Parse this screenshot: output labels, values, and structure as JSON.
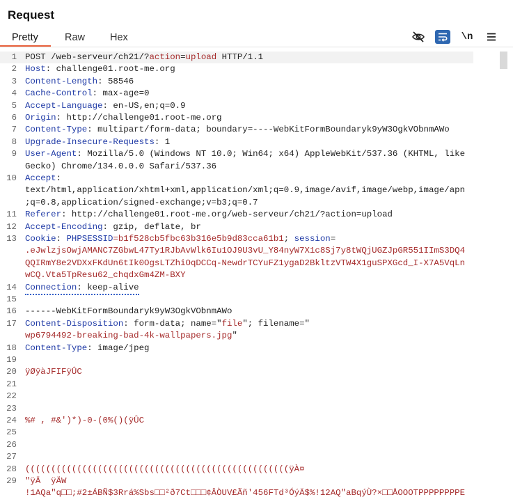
{
  "panel": {
    "title": "Request"
  },
  "tabs": [
    {
      "label": "Pretty"
    },
    {
      "label": "Raw"
    },
    {
      "label": "Hex"
    }
  ],
  "toolbar": {
    "hide_icon": "eye-slash-icon",
    "wrap_icon": "wrap-lines-icon",
    "newline_icon": "newline-icon",
    "menu_icon": "hamburger-menu-icon",
    "newline_label": "\\n"
  },
  "lines": [
    {
      "n": "1",
      "parts": [
        {
          "t": "POST /web-serveur/ch21/?",
          "c": ""
        },
        {
          "t": "action",
          "c": "r"
        },
        {
          "t": "=",
          "c": ""
        },
        {
          "t": "upload",
          "c": "r"
        },
        {
          "t": " HTTP/1.1",
          "c": ""
        }
      ]
    },
    {
      "n": "2",
      "parts": [
        {
          "t": "Host",
          "c": "k"
        },
        {
          "t": ": challenge01.root-me.org",
          "c": ""
        }
      ]
    },
    {
      "n": "3",
      "parts": [
        {
          "t": "Content-Length",
          "c": "k"
        },
        {
          "t": ": 58546",
          "c": ""
        }
      ]
    },
    {
      "n": "4",
      "parts": [
        {
          "t": "Cache-Control",
          "c": "k"
        },
        {
          "t": ": max-age=0",
          "c": ""
        }
      ]
    },
    {
      "n": "5",
      "parts": [
        {
          "t": "Accept-Language",
          "c": "k"
        },
        {
          "t": ": en-US,en;q=0.9",
          "c": ""
        }
      ]
    },
    {
      "n": "6",
      "parts": [
        {
          "t": "Origin",
          "c": "k"
        },
        {
          "t": ": http://challenge01.root-me.org",
          "c": ""
        }
      ]
    },
    {
      "n": "7",
      "parts": [
        {
          "t": "Content-Type",
          "c": "k"
        },
        {
          "t": ": multipart/form-data; boundary=----WebKitFormBoundaryk9yW3OgkVObnmAWo",
          "c": ""
        }
      ]
    },
    {
      "n": "8",
      "parts": [
        {
          "t": "Upgrade-Insecure-Requests",
          "c": "k"
        },
        {
          "t": ": 1",
          "c": ""
        }
      ]
    },
    {
      "n": "9",
      "parts": [
        {
          "t": "User-Agent",
          "c": "k"
        },
        {
          "t": ": Mozilla/5.0 (Windows NT 10.0; Win64; x64) AppleWebKit/537.36 (KHTML, like",
          "c": ""
        }
      ]
    },
    {
      "n": "",
      "parts": [
        {
          "t": "Gecko) Chrome/134.0.0.0 Safari/537.36",
          "c": ""
        }
      ]
    },
    {
      "n": "10",
      "parts": [
        {
          "t": "Accept",
          "c": "k"
        },
        {
          "t": ":",
          "c": ""
        }
      ]
    },
    {
      "n": "",
      "parts": [
        {
          "t": "text/html,application/xhtml+xml,application/xml;q=0.9,image/avif,image/webp,image/apn",
          "c": ""
        }
      ]
    },
    {
      "n": "",
      "parts": [
        {
          "t": ";q=0.8,application/signed-exchange;v=b3;q=0.7",
          "c": ""
        }
      ]
    },
    {
      "n": "11",
      "parts": [
        {
          "t": "Referer",
          "c": "k"
        },
        {
          "t": ": http://challenge01.root-me.org/web-serveur/ch21/?action=upload",
          "c": ""
        }
      ]
    },
    {
      "n": "12",
      "parts": [
        {
          "t": "Accept-Encoding",
          "c": "k"
        },
        {
          "t": ": gzip, deflate, br",
          "c": ""
        }
      ]
    },
    {
      "n": "13",
      "parts": [
        {
          "t": "Cookie",
          "c": "k"
        },
        {
          "t": ": ",
          "c": ""
        },
        {
          "t": "PHPSESSID",
          "c": "k"
        },
        {
          "t": "=b1f528cb5fbc63b316e5b9d83cca61b1",
          "c": "r"
        },
        {
          "t": "; ",
          "c": ""
        },
        {
          "t": "session",
          "c": "k"
        },
        {
          "t": "=",
          "c": ""
        }
      ]
    },
    {
      "n": "",
      "parts": [
        {
          "t": ".eJwlzjsOwjAMANC7ZGbwL47Ty1RJbAvWlk6Iu1OJ9U3vU_Y84nyW7X1c8Sj7y8tWQjUGZJpGR551IImS3DQ4",
          "c": "r"
        }
      ]
    },
    {
      "n": "",
      "parts": [
        {
          "t": "QQIRmY8e2VDXxFKdUn6tIk0OgsLTZhiOqDCCq-NewdrTCYuFZ1ygaD2BkltzVTW4X1guSPXGcd_I-X7A5VqLn",
          "c": "r"
        }
      ]
    },
    {
      "n": "",
      "parts": [
        {
          "t": "wCQ.Vta5TpResu62_chqdxGm4ZM-BXY",
          "c": "r"
        }
      ]
    },
    {
      "n": "14",
      "parts": [
        {
          "t": "Connection",
          "c": "k"
        },
        {
          "t": ": keep-alive",
          "c": ""
        }
      ]
    },
    {
      "n": "15",
      "parts": []
    },
    {
      "n": "16",
      "parts": [
        {
          "t": "------WebKitFormBoundaryk9yW3OgkVObnmAWo",
          "c": ""
        }
      ]
    },
    {
      "n": "17",
      "parts": [
        {
          "t": "Content-Disposition",
          "c": "k"
        },
        {
          "t": ": form-data; name=\"",
          "c": ""
        },
        {
          "t": "file",
          "c": "r"
        },
        {
          "t": "\"; filename=\"",
          "c": ""
        }
      ]
    },
    {
      "n": "",
      "parts": [
        {
          "t": "wp6794492-breaking-bad-4k-wallpapers.jpg",
          "c": "r"
        },
        {
          "t": "\"",
          "c": ""
        }
      ]
    },
    {
      "n": "18",
      "parts": [
        {
          "t": "Content-Type",
          "c": "k"
        },
        {
          "t": ": image/jpeg",
          "c": ""
        }
      ]
    },
    {
      "n": "19",
      "parts": []
    },
    {
      "n": "20",
      "parts": [
        {
          "t": "ÿØÿàJFIFÿÛC",
          "c": "r"
        }
      ]
    },
    {
      "n": "21",
      "parts": []
    },
    {
      "n": "22",
      "parts": []
    },
    {
      "n": "23",
      "parts": []
    },
    {
      "n": "24",
      "parts": [
        {
          "t": "%# , #&')*)-0-(0%()(ÿÛC",
          "c": "r"
        }
      ]
    },
    {
      "n": "25",
      "parts": []
    },
    {
      "n": "26",
      "parts": []
    },
    {
      "n": "27",
      "parts": []
    },
    {
      "n": "28",
      "parts": [
        {
          "t": "(((((((((((((((((((((((((((((((((((((((((((((((((((ÿÀ¤",
          "c": "r"
        }
      ]
    },
    {
      "n": "29",
      "parts": [
        {
          "t": "\"ÿÄ  ÿÄW",
          "c": "r"
        }
      ]
    },
    {
      "n": "",
      "parts": [
        {
          "t": "!1AQa\"q□□;#2±ÁBÑ$3Rrá%Sbs□□²ð7Ct□□□¢ÂÒUV£Ãñ'456FTd³ÓýÄ$%!12AQ\"aBqýÙ?×□□ÅOOOTPPPPPPPPE",
          "c": "r"
        }
      ]
    }
  ]
}
